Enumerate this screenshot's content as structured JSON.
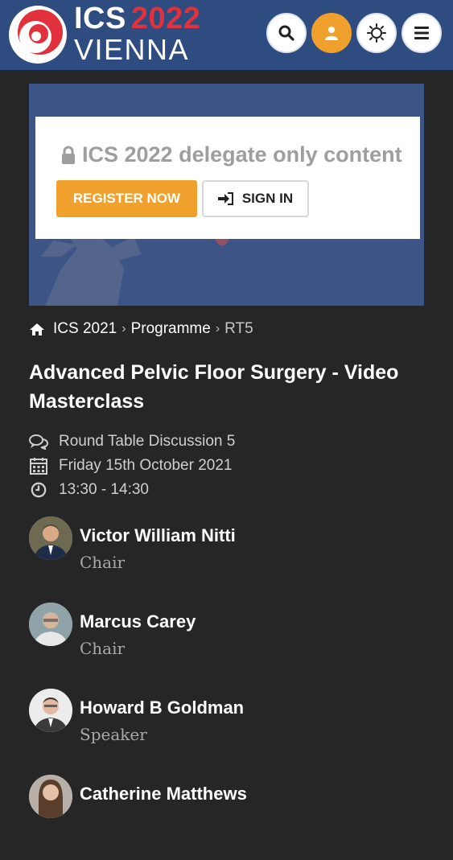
{
  "header": {
    "logo_line1_a": "ICS",
    "logo_line1_b": "2022",
    "logo_line2": "VIENNA",
    "icons": [
      "search-icon",
      "user-icon",
      "brightness-icon",
      "menu-icon"
    ],
    "colors": {
      "header_bg": "#2f4c80",
      "accent": "#f0a12d",
      "brand_red": "#e0313c"
    }
  },
  "banner": {
    "locked_message": "ICS 2022 delegate only content",
    "register_label": "REGISTER NOW",
    "signin_label": "SIGN IN"
  },
  "breadcrumb": {
    "items": [
      "ICS 2021",
      "Programme"
    ],
    "current": "RT5"
  },
  "session": {
    "title": "Advanced Pelvic Floor Surgery - Video Masterclass",
    "type": "Round Table Discussion 5",
    "date": "Friday 15th October 2021",
    "time": "13:30 - 14:30"
  },
  "speakers": [
    {
      "name": "Victor William Nitti",
      "role": "Chair"
    },
    {
      "name": "Marcus Carey",
      "role": "Chair"
    },
    {
      "name": "Howard B Goldman",
      "role": "Speaker"
    },
    {
      "name": "Catherine Matthews",
      "role": ""
    }
  ]
}
